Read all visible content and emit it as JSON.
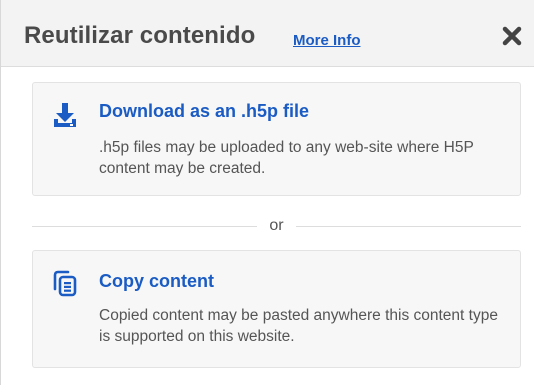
{
  "dialog": {
    "title": "Reutilizar contenido",
    "more_info_link": "More Info",
    "close_icon": "close-icon"
  },
  "options": [
    {
      "icon": "download-icon",
      "title": "Download as an .h5p file",
      "description": ".h5p files may be uploaded to any web-site where H5P content may be created."
    },
    {
      "icon": "copy-icon",
      "title": "Copy content",
      "description": "Copied content may be pasted anywhere this content type is supported on this website."
    }
  ],
  "divider": {
    "text": "or"
  },
  "colors": {
    "accent": "#1a5bc4",
    "header_bg": "#f3f3f3",
    "card_bg": "#f7f7f7",
    "title_text": "#4a4a4a"
  }
}
